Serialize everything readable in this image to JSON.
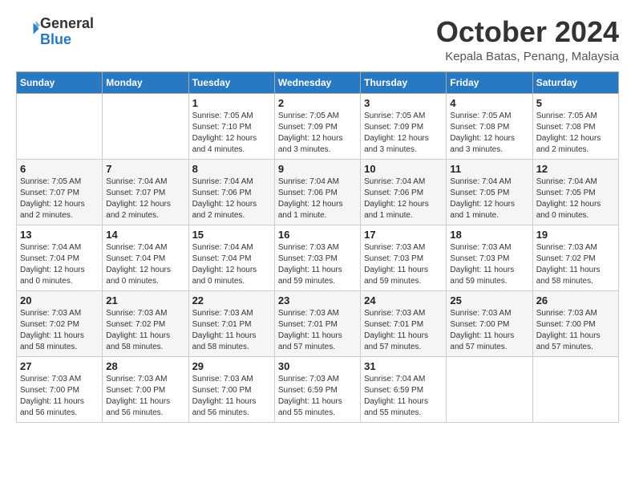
{
  "logo": {
    "line1": "General",
    "line2": "Blue"
  },
  "title": "October 2024",
  "location": "Kepala Batas, Penang, Malaysia",
  "days_of_week": [
    "Sunday",
    "Monday",
    "Tuesday",
    "Wednesday",
    "Thursday",
    "Friday",
    "Saturday"
  ],
  "weeks": [
    [
      {
        "day": "",
        "info": ""
      },
      {
        "day": "",
        "info": ""
      },
      {
        "day": "1",
        "info": "Sunrise: 7:05 AM\nSunset: 7:10 PM\nDaylight: 12 hours and 4 minutes."
      },
      {
        "day": "2",
        "info": "Sunrise: 7:05 AM\nSunset: 7:09 PM\nDaylight: 12 hours and 3 minutes."
      },
      {
        "day": "3",
        "info": "Sunrise: 7:05 AM\nSunset: 7:09 PM\nDaylight: 12 hours and 3 minutes."
      },
      {
        "day": "4",
        "info": "Sunrise: 7:05 AM\nSunset: 7:08 PM\nDaylight: 12 hours and 3 minutes."
      },
      {
        "day": "5",
        "info": "Sunrise: 7:05 AM\nSunset: 7:08 PM\nDaylight: 12 hours and 2 minutes."
      }
    ],
    [
      {
        "day": "6",
        "info": "Sunrise: 7:05 AM\nSunset: 7:07 PM\nDaylight: 12 hours and 2 minutes."
      },
      {
        "day": "7",
        "info": "Sunrise: 7:04 AM\nSunset: 7:07 PM\nDaylight: 12 hours and 2 minutes."
      },
      {
        "day": "8",
        "info": "Sunrise: 7:04 AM\nSunset: 7:06 PM\nDaylight: 12 hours and 2 minutes."
      },
      {
        "day": "9",
        "info": "Sunrise: 7:04 AM\nSunset: 7:06 PM\nDaylight: 12 hours and 1 minute."
      },
      {
        "day": "10",
        "info": "Sunrise: 7:04 AM\nSunset: 7:06 PM\nDaylight: 12 hours and 1 minute."
      },
      {
        "day": "11",
        "info": "Sunrise: 7:04 AM\nSunset: 7:05 PM\nDaylight: 12 hours and 1 minute."
      },
      {
        "day": "12",
        "info": "Sunrise: 7:04 AM\nSunset: 7:05 PM\nDaylight: 12 hours and 0 minutes."
      }
    ],
    [
      {
        "day": "13",
        "info": "Sunrise: 7:04 AM\nSunset: 7:04 PM\nDaylight: 12 hours and 0 minutes."
      },
      {
        "day": "14",
        "info": "Sunrise: 7:04 AM\nSunset: 7:04 PM\nDaylight: 12 hours and 0 minutes."
      },
      {
        "day": "15",
        "info": "Sunrise: 7:04 AM\nSunset: 7:04 PM\nDaylight: 12 hours and 0 minutes."
      },
      {
        "day": "16",
        "info": "Sunrise: 7:03 AM\nSunset: 7:03 PM\nDaylight: 11 hours and 59 minutes."
      },
      {
        "day": "17",
        "info": "Sunrise: 7:03 AM\nSunset: 7:03 PM\nDaylight: 11 hours and 59 minutes."
      },
      {
        "day": "18",
        "info": "Sunrise: 7:03 AM\nSunset: 7:03 PM\nDaylight: 11 hours and 59 minutes."
      },
      {
        "day": "19",
        "info": "Sunrise: 7:03 AM\nSunset: 7:02 PM\nDaylight: 11 hours and 58 minutes."
      }
    ],
    [
      {
        "day": "20",
        "info": "Sunrise: 7:03 AM\nSunset: 7:02 PM\nDaylight: 11 hours and 58 minutes."
      },
      {
        "day": "21",
        "info": "Sunrise: 7:03 AM\nSunset: 7:02 PM\nDaylight: 11 hours and 58 minutes."
      },
      {
        "day": "22",
        "info": "Sunrise: 7:03 AM\nSunset: 7:01 PM\nDaylight: 11 hours and 58 minutes."
      },
      {
        "day": "23",
        "info": "Sunrise: 7:03 AM\nSunset: 7:01 PM\nDaylight: 11 hours and 57 minutes."
      },
      {
        "day": "24",
        "info": "Sunrise: 7:03 AM\nSunset: 7:01 PM\nDaylight: 11 hours and 57 minutes."
      },
      {
        "day": "25",
        "info": "Sunrise: 7:03 AM\nSunset: 7:00 PM\nDaylight: 11 hours and 57 minutes."
      },
      {
        "day": "26",
        "info": "Sunrise: 7:03 AM\nSunset: 7:00 PM\nDaylight: 11 hours and 57 minutes."
      }
    ],
    [
      {
        "day": "27",
        "info": "Sunrise: 7:03 AM\nSunset: 7:00 PM\nDaylight: 11 hours and 56 minutes."
      },
      {
        "day": "28",
        "info": "Sunrise: 7:03 AM\nSunset: 7:00 PM\nDaylight: 11 hours and 56 minutes."
      },
      {
        "day": "29",
        "info": "Sunrise: 7:03 AM\nSunset: 7:00 PM\nDaylight: 11 hours and 56 minutes."
      },
      {
        "day": "30",
        "info": "Sunrise: 7:03 AM\nSunset: 6:59 PM\nDaylight: 11 hours and 55 minutes."
      },
      {
        "day": "31",
        "info": "Sunrise: 7:04 AM\nSunset: 6:59 PM\nDaylight: 11 hours and 55 minutes."
      },
      {
        "day": "",
        "info": ""
      },
      {
        "day": "",
        "info": ""
      }
    ]
  ]
}
